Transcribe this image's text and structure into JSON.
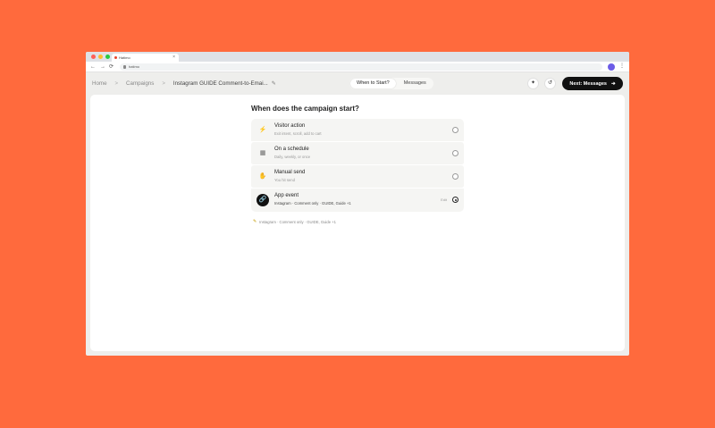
{
  "browser": {
    "tab_title": "Hatimo",
    "tab_close": "×",
    "url": "hatimo",
    "back": "←",
    "forward": "→",
    "reload": "⟳",
    "menu": "⋮",
    "dot_colors": [
      "#FF5F57",
      "#FEBC2E",
      "#28C840"
    ]
  },
  "header": {
    "breadcrumbs": [
      "Home",
      "Campaigns",
      "Instagram GUIDE Comment-to-Emai..."
    ],
    "separator": ">",
    "edit_icon": "✎",
    "tabs": [
      {
        "label": "When to Start?",
        "active": true
      },
      {
        "label": "Messages",
        "active": false
      }
    ],
    "magic_icon": "✦",
    "history_icon": "↺",
    "next_label": "Next: Messages",
    "next_arrow": "➔"
  },
  "main": {
    "question": "When does the campaign start?",
    "options": [
      {
        "title": "Visitor action",
        "subtitle": "Exit intent, scroll, add to cart",
        "icon": "bolt-icon",
        "glyph": "⚡",
        "selected": false
      },
      {
        "title": "On a schedule",
        "subtitle": "Daily, weekly, or once",
        "icon": "calendar-icon",
        "glyph": "▦",
        "selected": false
      },
      {
        "title": "Manual send",
        "subtitle": "You hit send",
        "icon": "hand-icon",
        "glyph": "✋",
        "selected": false
      },
      {
        "title": "App event",
        "subtitle": "Instagram · Comment only · GUIDE, Guide +1",
        "icon": "link-icon",
        "glyph": "🔗",
        "selected": true,
        "edit_label": "Edit"
      }
    ],
    "summary": "Instagram · Comment only · GUIDE, Guide +1",
    "summary_icon": "✎"
  }
}
